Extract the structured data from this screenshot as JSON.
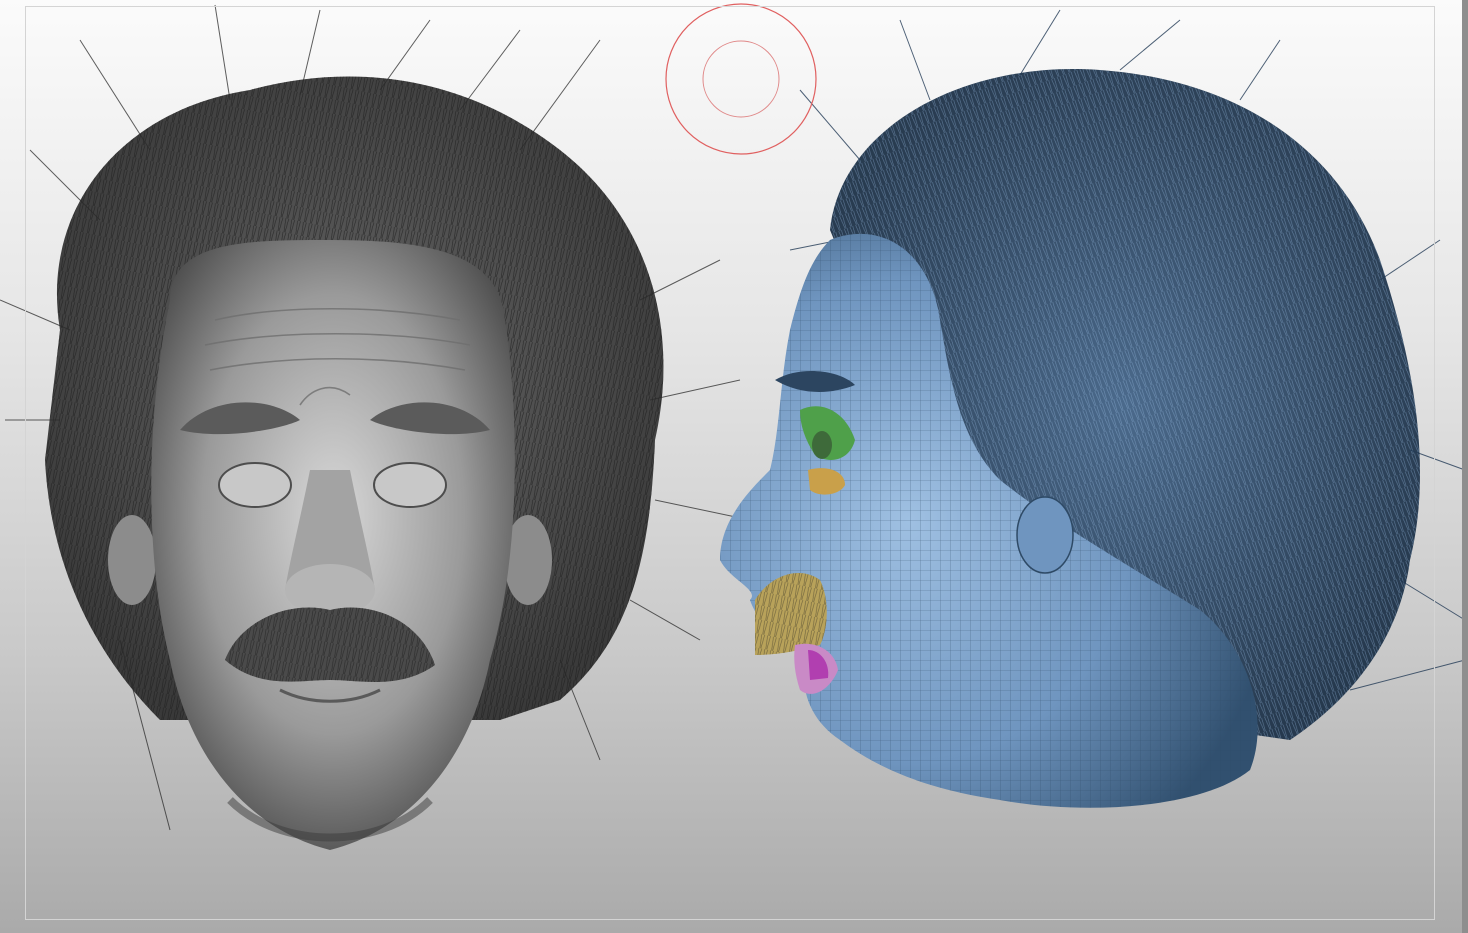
{
  "viewport": {
    "background_top": "#fbfbfb",
    "background_bottom": "#aaaaaa"
  },
  "brush_cursor": {
    "icon": "brush-cursor-icon",
    "color": "#e06060"
  },
  "front_view": {
    "model": "sculpted-head-front",
    "material_color": "#8a8a8a",
    "hair_color": "#3a3a3a"
  },
  "side_view": {
    "model": "polygroup-head-side",
    "material_color": "#6f95bf",
    "hair_color": "#2c4560",
    "polygroup_colors": [
      "#6f95bf",
      "#4fa04a",
      "#c9a04a",
      "#c98ac6",
      "#b8a25a"
    ]
  }
}
